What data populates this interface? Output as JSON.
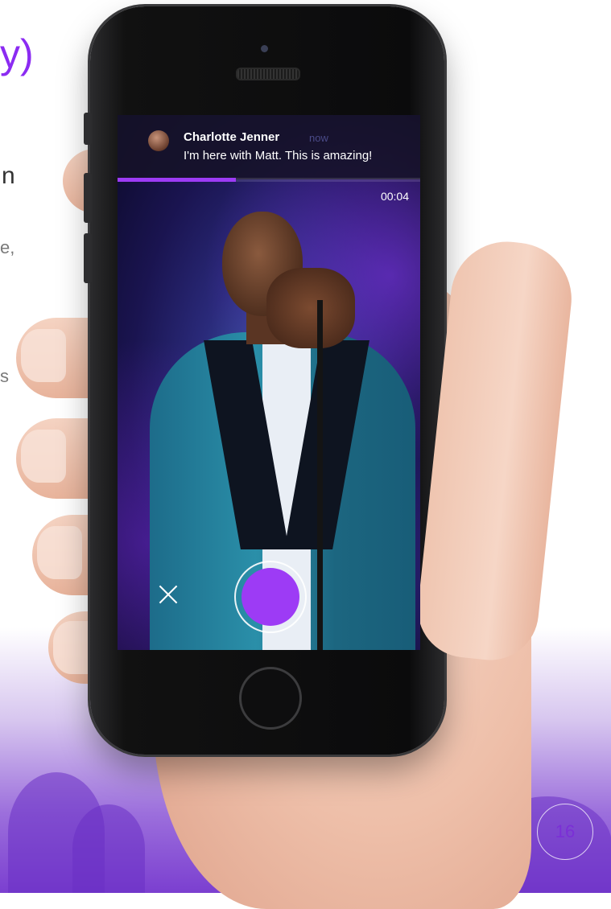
{
  "slide": {
    "title_fragment": "y)",
    "subtitle_fragment": "n",
    "body_fragments": [
      "e,",
      "s"
    ],
    "page_number": "16",
    "accent_color": "#8b2bf2"
  },
  "phone_screen": {
    "message": {
      "author": "Charlotte Jenner",
      "time": "now",
      "text": "I'm here with Matt. This is amazing!"
    },
    "progress_fraction": 0.39,
    "timer": "00:04",
    "close_icon": "close-icon",
    "record_button_color": "#9d3bf5"
  }
}
